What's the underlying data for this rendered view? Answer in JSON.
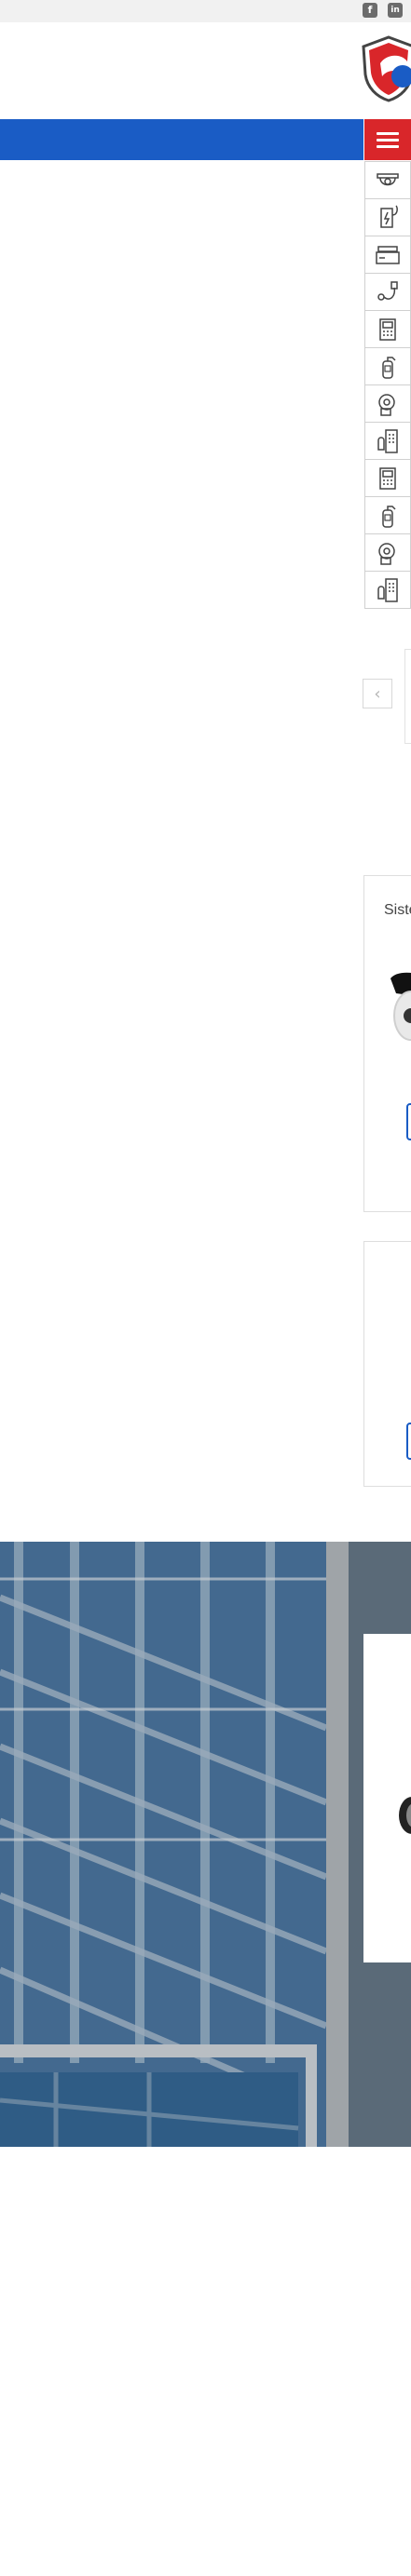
{
  "header": {
    "social": [
      {
        "name": "facebook-icon",
        "glyph": "f"
      },
      {
        "name": "linkedin-icon",
        "glyph": "in"
      }
    ],
    "logo_colors": {
      "red": "#d9262a",
      "blue": "#1a5cc5"
    }
  },
  "navbar": {
    "color": "#1a5cc5",
    "menu_button_color": "#d9262a"
  },
  "categories": [
    {
      "icon": "cctv-camera-icon"
    },
    {
      "icon": "power-supply-icon"
    },
    {
      "icon": "dvr-recorder-icon"
    },
    {
      "icon": "cable-icon"
    },
    {
      "icon": "intercom-icon"
    },
    {
      "icon": "fire-extinguisher-icon"
    },
    {
      "icon": "alarm-siren-icon"
    },
    {
      "icon": "access-keypad-icon"
    },
    {
      "icon": "intercom-icon"
    },
    {
      "icon": "fire-extinguisher-icon"
    },
    {
      "icon": "alarm-siren-icon"
    },
    {
      "icon": "access-keypad-icon"
    }
  ],
  "slider": {
    "prev_glyph": "‹"
  },
  "cards": [
    {
      "title": "Siste"
    }
  ]
}
